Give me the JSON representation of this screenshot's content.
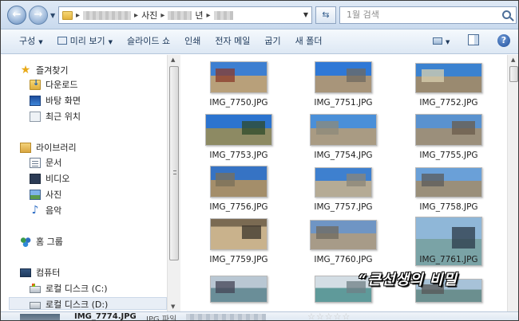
{
  "address": {
    "crumb_1": "사진",
    "crumb_2": "년",
    "search_placeholder": "1월 검색"
  },
  "toolbar": {
    "organize": "구성",
    "preview": "미리 보기",
    "slideshow": "슬라이드 쇼",
    "print": "인쇄",
    "email": "전자 메일",
    "burn": "굽기",
    "new_folder": "새 폴더"
  },
  "nav": {
    "favorites": "즐겨찾기",
    "downloads": "다운로드",
    "desktop": "바탕 화면",
    "recent": "최근 위치",
    "libraries": "라이브러리",
    "documents": "문서",
    "videos": "비디오",
    "pictures": "사진",
    "music": "음악",
    "homegroup": "홈 그룹",
    "computer": "컴퓨터",
    "local_c": "로컬 디스크 (C:)",
    "local_d": "로컬 디스크 (D:)"
  },
  "files": [
    {
      "name": "IMG_7750.JPG",
      "sky": "#3d7fd1",
      "ground": "#b8a07a",
      "accent": "#8a3a2a"
    },
    {
      "name": "IMG_7751.JPG",
      "sky": "#2f78d6",
      "ground": "#a8957a",
      "accent": "#6f6a60"
    },
    {
      "name": "IMG_7752.JPG",
      "sky": "#3b82d0",
      "ground": "#9a8a70",
      "accent": "#d9d0b0"
    },
    {
      "name": "IMG_7753.JPG",
      "sky": "#2c74cf",
      "ground": "#8d8a63",
      "accent": "#2e4a2a"
    },
    {
      "name": "IMG_7754.JPG",
      "sky": "#4a8fd8",
      "ground": "#a99b83",
      "accent": "#8e8a7a"
    },
    {
      "name": "IMG_7755.JPG",
      "sky": "#5a92cf",
      "ground": "#9b8f7b",
      "accent": "#6a5b4b"
    },
    {
      "name": "IMG_7756.JPG",
      "sky": "#3673c4",
      "ground": "#a48e6a",
      "accent": "#7a6f5a"
    },
    {
      "name": "IMG_7757.JPG",
      "sky": "#3e80cf",
      "ground": "#b5ab95",
      "accent": "#8b8578"
    },
    {
      "name": "IMG_7758.JPG",
      "sky": "#6aa0d8",
      "ground": "#9a8f7a",
      "accent": "#5b5b5b"
    },
    {
      "name": "IMG_7759.JPG",
      "sky": "#7a6a52",
      "ground": "#c9b28c",
      "accent": "#3a342b"
    },
    {
      "name": "IMG_7760.JPG",
      "sky": "#6f95c4",
      "ground": "#a79b88",
      "accent": "#6f6a5e"
    },
    {
      "name": "IMG_7761.JPG",
      "sky": "#8fb7d8",
      "ground": "#7aa3a6",
      "accent": "#2b3a48"
    },
    {
      "name": "",
      "sky": "#b9c7d3",
      "ground": "#6a8e98",
      "accent": "#445"
    },
    {
      "name": "",
      "sky": "#d3dde4",
      "ground": "#5f9a9a",
      "accent": "#6f7f86"
    },
    {
      "name": "",
      "sky": "#a7c2d8",
      "ground": "#6b8f8f",
      "accent": "#555"
    }
  ],
  "details": {
    "name": "IMG_7774.JPG",
    "type": "JPG 파일"
  },
  "watermark": "“큰선생의 비밀"
}
